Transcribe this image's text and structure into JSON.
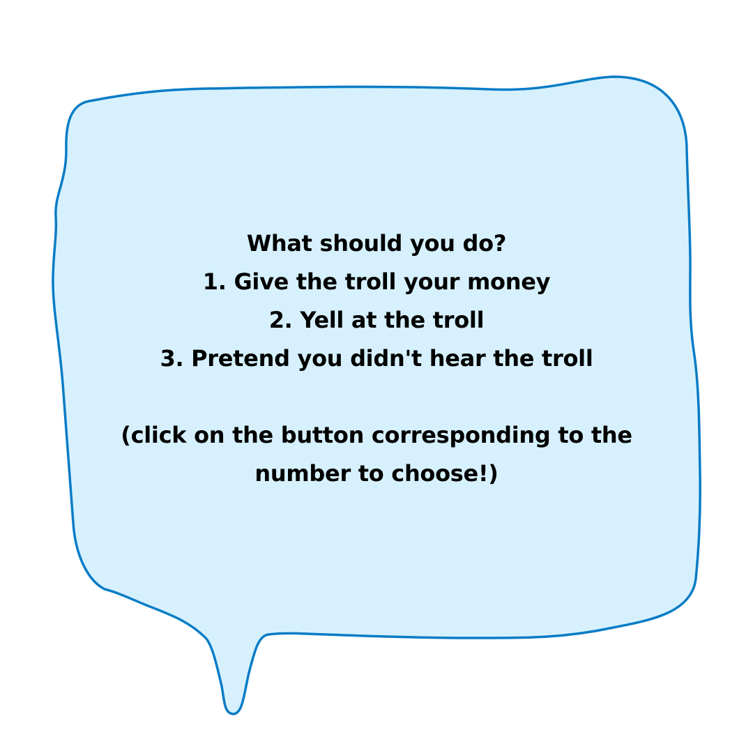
{
  "bubble": {
    "fill_color": "#d6f1fd",
    "stroke_color": "#0a7cc6",
    "question": "What should you do?",
    "options": [
      "1. Give the troll your money",
      "2. Yell at the troll",
      "3. Pretend you didn't hear the troll"
    ],
    "instruction_line1": "(click on the button corresponding to the",
    "instruction_line2": "number to choose!)"
  }
}
